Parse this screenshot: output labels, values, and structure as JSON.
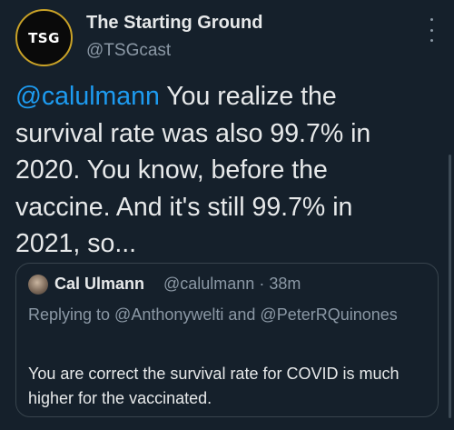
{
  "tweet": {
    "avatar_text": "TSG",
    "display_name": "The Starting Ground",
    "handle": "@TSGcast",
    "mention": "@calulmann",
    "text": " You realize the survival rate was also 99.7% in 2020. You know, before the vaccine. And it's still 99.7% in 2021, so..."
  },
  "quote": {
    "display_name": "Cal Ulmann",
    "meta": "@calulmann · 38m",
    "replying_to": "Replying to @Anthonywelti and @PeterRQuinones",
    "text": "You are correct the survival rate for COVID is much higher for the vaccinated."
  },
  "icons": {
    "more": "more-vertical-icon"
  },
  "colors": {
    "background": "#15202b",
    "text": "#e7e9ea",
    "secondary": "#8b98a5",
    "link": "#1d9bf0",
    "border": "#38444d"
  }
}
